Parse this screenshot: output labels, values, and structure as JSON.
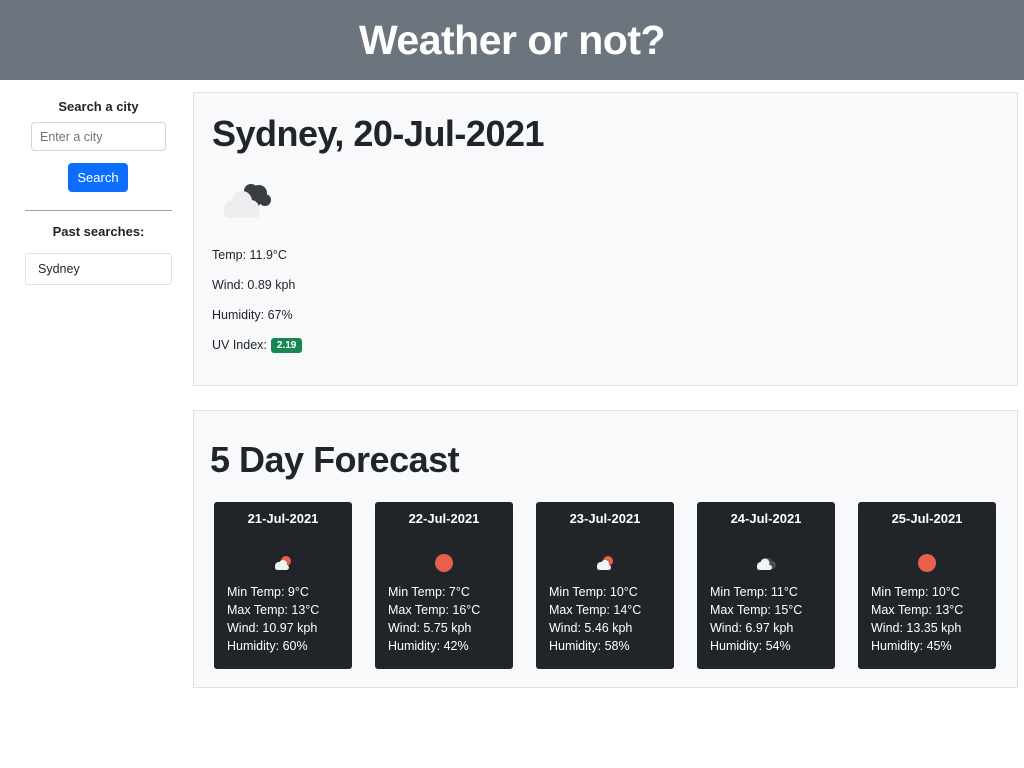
{
  "app": {
    "title": "Weather or not?"
  },
  "sidebar": {
    "search_label": "Search a city",
    "search_placeholder": "Enter a city",
    "search_value": "",
    "search_button": "Search",
    "past_label": "Past searches:",
    "past_searches": [
      "Sydney"
    ]
  },
  "current": {
    "heading": "Sydney, 20-Jul-2021",
    "icon": "cloudy-night-icon",
    "temp": "Temp: 11.9°C",
    "wind": "Wind: 0.89 kph",
    "humidity": "Humidity: 67%",
    "uv_label": "UV Index:",
    "uv_value": "2.19",
    "uv_color": "#198754"
  },
  "forecast": {
    "heading": "5 Day Forecast",
    "days": [
      {
        "date": "21-Jul-2021",
        "icon": "partly-cloudy-icon",
        "min": "Min Temp: 9°C",
        "max": "Max Temp: 13°C",
        "wind": "Wind: 10.97 kph",
        "humidity": "Humidity: 60%"
      },
      {
        "date": "22-Jul-2021",
        "icon": "sun-icon",
        "min": "Min Temp: 7°C",
        "max": "Max Temp: 16°C",
        "wind": "Wind: 5.75 kph",
        "humidity": "Humidity: 42%"
      },
      {
        "date": "23-Jul-2021",
        "icon": "partly-cloudy-icon",
        "min": "Min Temp: 10°C",
        "max": "Max Temp: 14°C",
        "wind": "Wind: 5.46 kph",
        "humidity": "Humidity: 58%"
      },
      {
        "date": "24-Jul-2021",
        "icon": "cloudy-icon",
        "min": "Min Temp: 11°C",
        "max": "Max Temp: 15°C",
        "wind": "Wind: 6.97 kph",
        "humidity": "Humidity: 54%"
      },
      {
        "date": "25-Jul-2021",
        "icon": "sun-icon",
        "min": "Min Temp: 10°C",
        "max": "Max Temp: 13°C",
        "wind": "Wind: 13.35 kph",
        "humidity": "Humidity: 45%"
      }
    ]
  }
}
